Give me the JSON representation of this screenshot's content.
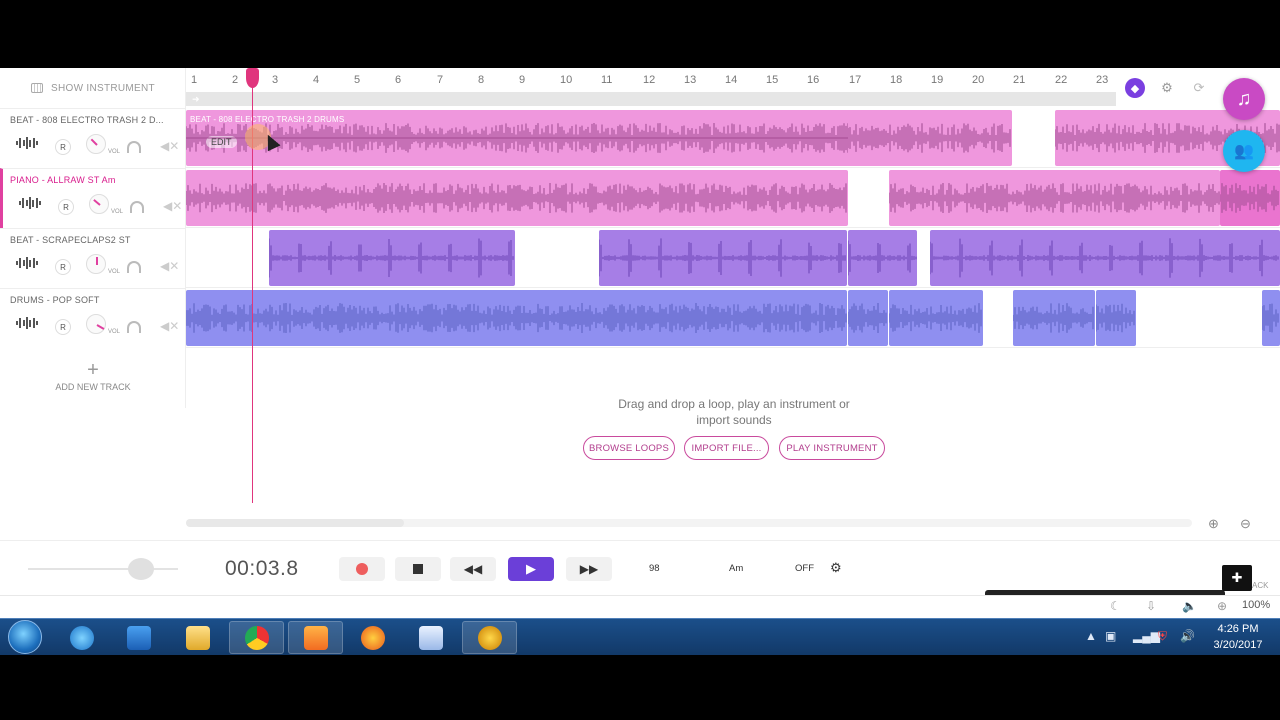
{
  "sidebar": {
    "show_instrument": "SHOW INSTRUMENT",
    "tracks": [
      {
        "name": "BEAT - 808 ELECTRO TRASH 2 D...",
        "r": "R",
        "vol": "VOL"
      },
      {
        "name": "PIANO - ALLRAW ST Am",
        "r": "R",
        "vol": "VOL"
      },
      {
        "name": "BEAT - SCRAPECLAPS2 ST",
        "r": "R",
        "vol": "VOL"
      },
      {
        "name": "DRUMS - POP SOFT",
        "r": "R",
        "vol": "VOL"
      }
    ],
    "add_new_track": "ADD NEW TRACK"
  },
  "ruler": {
    "bars": [
      "1",
      "2",
      "3",
      "4",
      "5",
      "6",
      "7",
      "8",
      "9",
      "10",
      "11",
      "12",
      "13",
      "14",
      "15",
      "16",
      "17",
      "18",
      "19",
      "20",
      "21",
      "22",
      "23"
    ]
  },
  "timeline": {
    "clip_label": "BEAT - 808 ELECTRO TRASH 2 DRUMS",
    "edit_label": "EDIT"
  },
  "empty_state": {
    "message_line1": "Drag and drop a loop, play an instrument or",
    "message_line2": "import sounds",
    "browse_loops": "BROWSE LOOPS",
    "import_file": "IMPORT FILE...",
    "play_instrument": "PLAY INSTRUMENT"
  },
  "transport": {
    "time": "00:03.8",
    "tempo": "98",
    "key": "Am",
    "metronome": "OFF"
  },
  "statusbar": {
    "zoom": "100%",
    "cut_text": "ACK"
  },
  "taskbar": {
    "time": "4:26 PM",
    "date": "3/20/2017"
  },
  "colors": {
    "accent_pink": "#e0357d",
    "play_purple": "#6b3fd8",
    "clip_pink": "#ef97dd",
    "clip_violet": "#a67ee6",
    "clip_blue": "#8f8ff0"
  },
  "icons": {
    "top_right": [
      "diamond-icon",
      "gear-icon",
      "refresh-icon"
    ],
    "fabs": [
      "music-note-icon",
      "group-icon"
    ]
  }
}
